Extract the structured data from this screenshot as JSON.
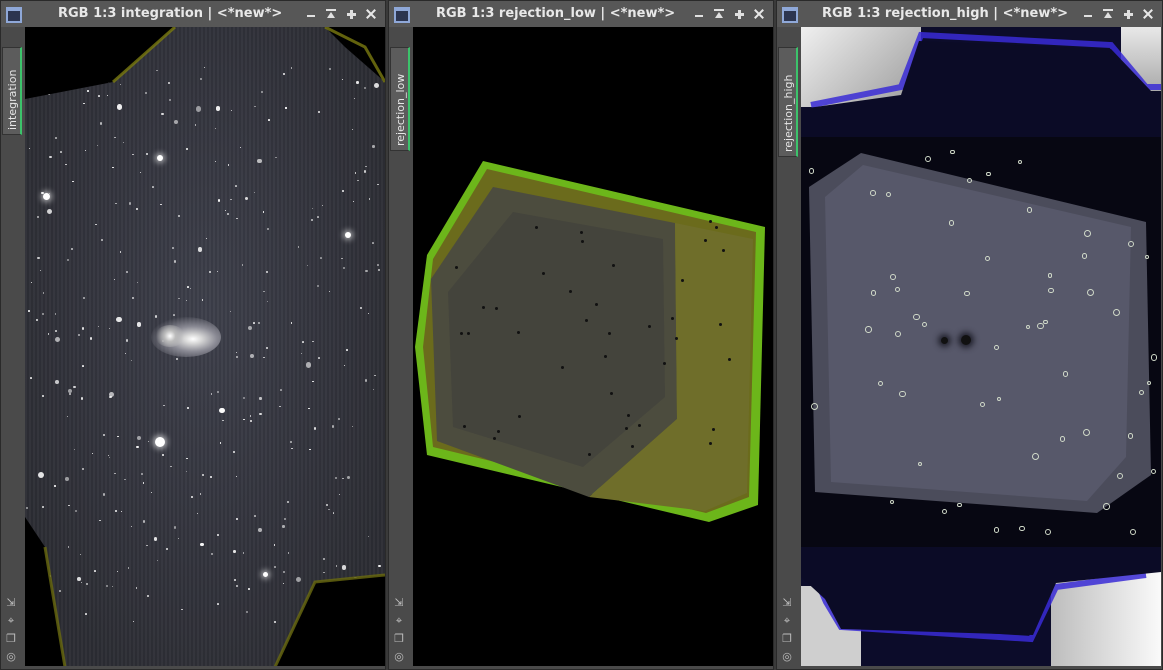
{
  "windows": [
    {
      "title": "RGB 1:3 integration | <*new*>",
      "tab_label": "integration"
    },
    {
      "title": "RGB 1:3 rejection_low | <*new*>",
      "tab_label": "rejection_low"
    },
    {
      "title": "RGB 1:3 rejection_high | <*new*>",
      "tab_label": "rejection_high"
    }
  ],
  "window_buttons": {
    "minimize": "minimize-icon",
    "shade": "shade-icon",
    "maximize": "maximize-icon",
    "close": "close-icon"
  },
  "side_tools": [
    "resize-icon",
    "crosshair-icon",
    "clone-icon",
    "target-icon"
  ],
  "colors": {
    "titlebar": "#575757",
    "tab_accent": "#3cc36b",
    "low_edge": "#7fd61f",
    "high_edge": "#3a2bd6"
  }
}
